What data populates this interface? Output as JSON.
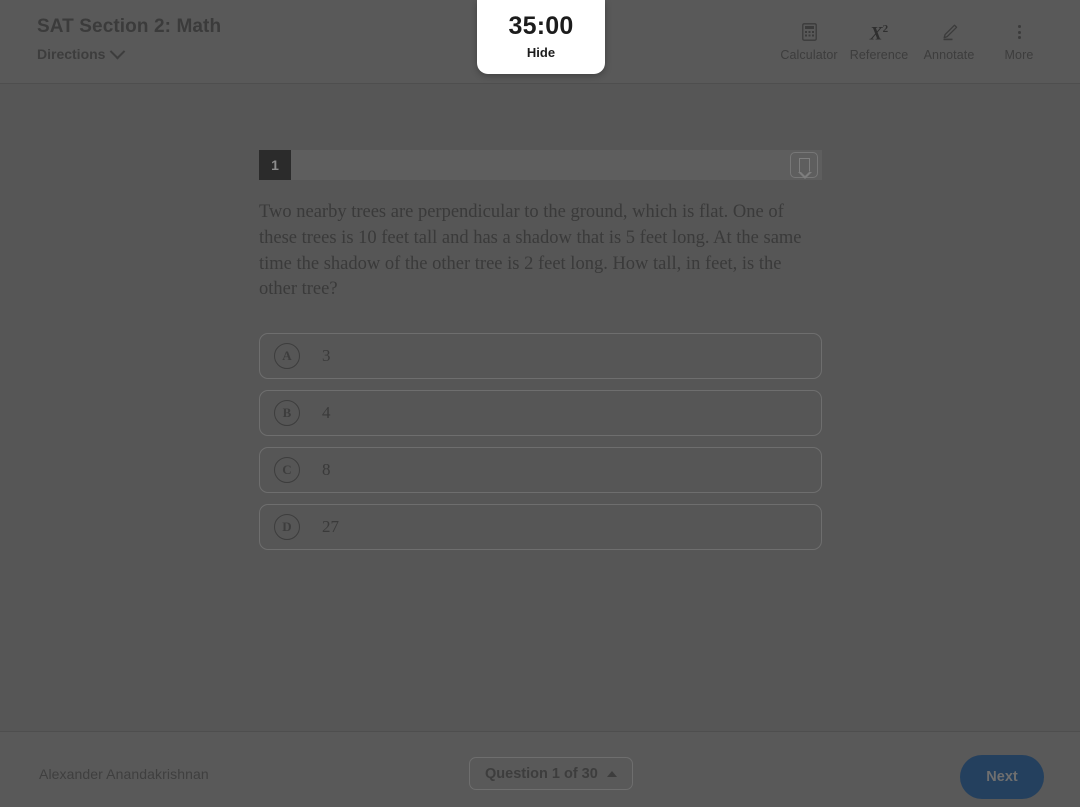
{
  "header": {
    "section_title": "SAT Section 2: Math",
    "directions_label": "Directions",
    "directions_icon": "chevron-down-icon"
  },
  "timer": {
    "value": "35:00",
    "hide_label": "Hide"
  },
  "tools": [
    {
      "label": "Calculator",
      "icon": "calculator-icon"
    },
    {
      "label": "Reference",
      "icon": "x-squared-icon"
    },
    {
      "label": "Annotate",
      "icon": "highlighter-pen-icon"
    },
    {
      "label": "More",
      "icon": "more-vertical-dots-icon"
    }
  ],
  "question": {
    "number": "1",
    "bookmark_icon": "bookmark-icon",
    "text": "Two nearby trees are perpendicular to the ground, which is flat. One of these trees is 10 feet tall and has a shadow that is 5 feet long. At the same time the shadow of the other tree is 2 feet long. How tall, in feet, is the other tree?",
    "options": [
      {
        "letter": "A",
        "text": "3"
      },
      {
        "letter": "B",
        "text": "4"
      },
      {
        "letter": "C",
        "text": "8"
      },
      {
        "letter": "D",
        "text": "27"
      }
    ]
  },
  "footer": {
    "student_name": "Alexander Anandakrishnan",
    "question_selector_label": "Question 1 of 30",
    "question_selector_icon": "triangle-up-icon",
    "next_label": "Next"
  },
  "colors": {
    "overlay_scrim": "#565656",
    "header_bg": "#595959",
    "timer_card_bg": "#ffffff",
    "next_button_bg": "#24405e",
    "question_badge_bg": "#2b2b2b"
  }
}
